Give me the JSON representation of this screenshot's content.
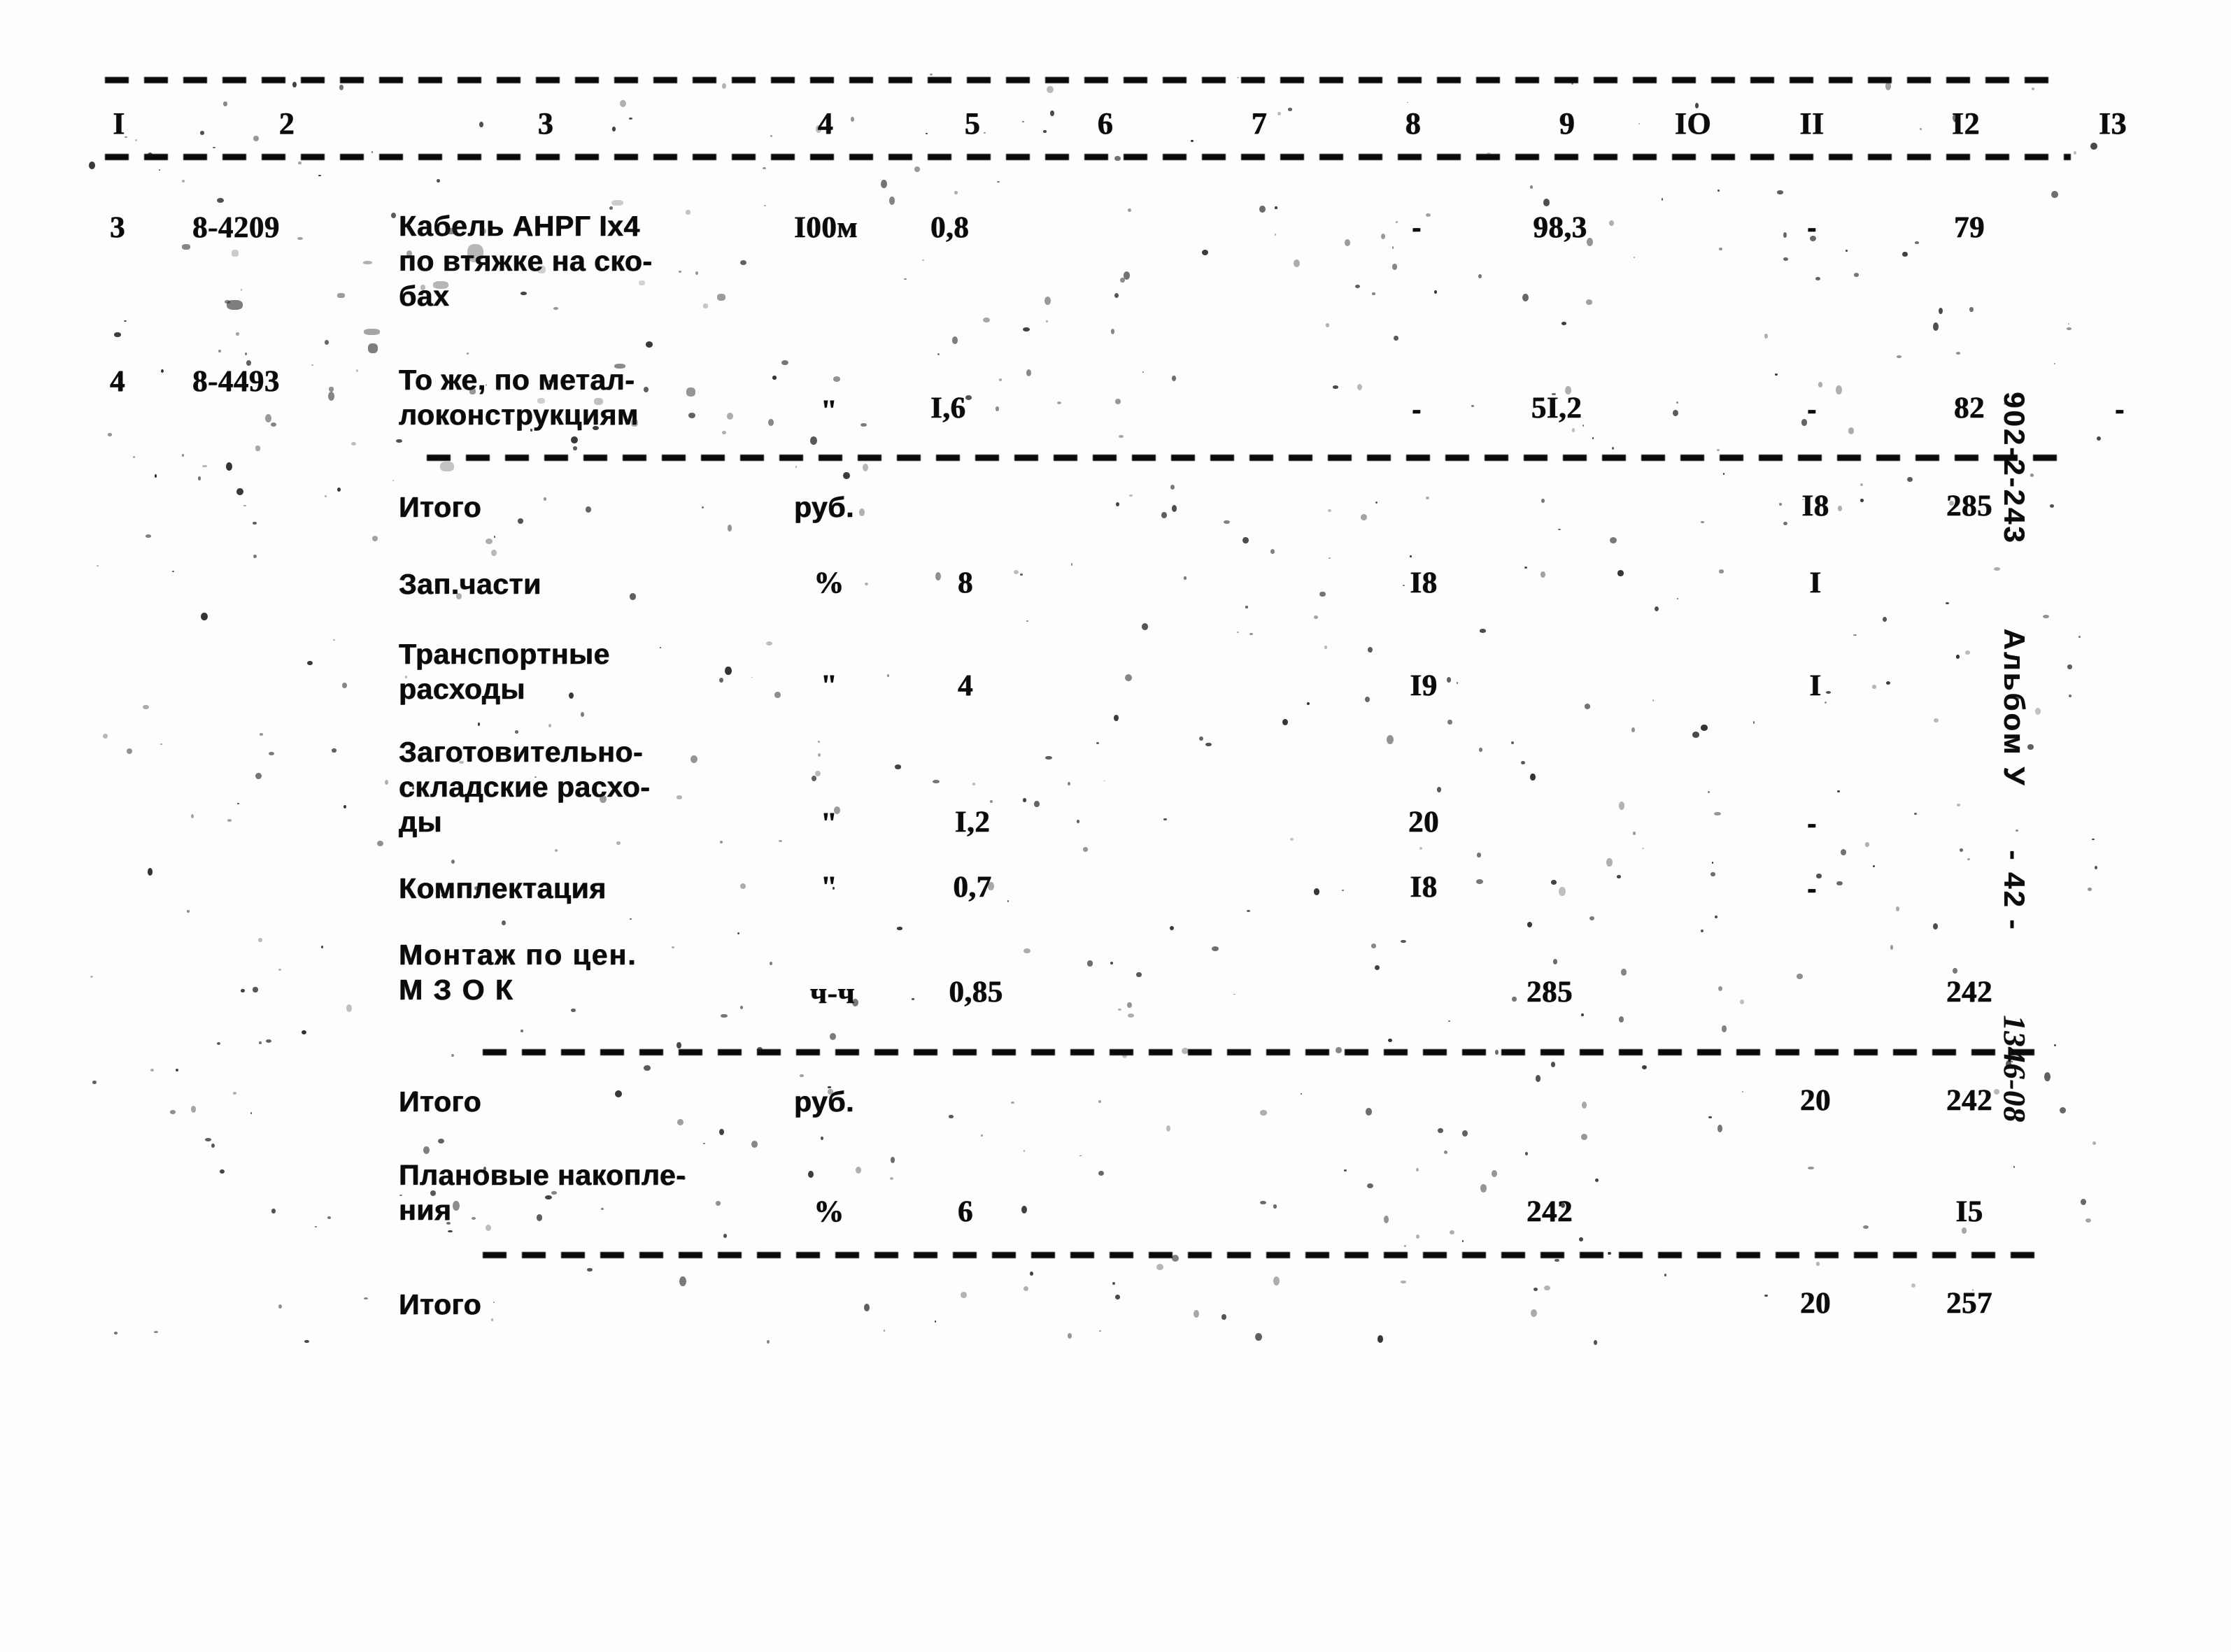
{
  "document": {
    "type": "scanned-estimate-table",
    "margin_stamp": {
      "code": "902-2-243",
      "album": "Альбом У",
      "page": "- 42 -",
      "annotation": "1346-08"
    }
  },
  "table": {
    "column_headers": [
      "I",
      "2",
      "3",
      "4",
      "5",
      "6",
      "7",
      "8",
      "9",
      "IO",
      "II",
      "I2",
      "I3"
    ],
    "rows": [
      {
        "kind": "item",
        "c1": "3",
        "c2": "8-4209",
        "c3": "Кабель АНРГ Iх4\nпо втяжке на ско-\nбах",
        "c4": "I00м",
        "c5": "0,8",
        "c6": "",
        "c7": "",
        "c8": "-",
        "c9": "98,3",
        "c10": "",
        "c11": "-",
        "c12": "79",
        "c13": ""
      },
      {
        "kind": "item",
        "c1": "4",
        "c2": "8-4493",
        "c3": "То же, по метал-\nлоконструкциям",
        "c4": "\"",
        "c5": "I,6",
        "c6": "",
        "c7": "",
        "c8": "-",
        "c9": "5I,2",
        "c10": "",
        "c11": "-",
        "c12": "82",
        "c13": "-"
      },
      {
        "kind": "total",
        "c1": "",
        "c2": "",
        "c3": "Итого",
        "c4": "руб.",
        "c5": "",
        "c6": "",
        "c7": "",
        "c8": "",
        "c9": "",
        "c10": "",
        "c11": "I8",
        "c12": "285",
        "c13": ""
      },
      {
        "kind": "item",
        "c1": "",
        "c2": "",
        "c3": "Зап.части",
        "c4": "%",
        "c5": "8",
        "c6": "",
        "c7": "",
        "c8": "I8",
        "c9": "",
        "c10": "",
        "c11": "I",
        "c12": "",
        "c13": ""
      },
      {
        "kind": "item",
        "c1": "",
        "c2": "",
        "c3": "Транспортные\nрасходы",
        "c4": "\"",
        "c5": "4",
        "c6": "",
        "c7": "",
        "c8": "I9",
        "c9": "",
        "c10": "",
        "c11": "I",
        "c12": "",
        "c13": ""
      },
      {
        "kind": "item",
        "c1": "",
        "c2": "",
        "c3": "Заготовительно-\nскладские расхо-\nды",
        "c4": "\"",
        "c5": "I,2",
        "c6": "",
        "c7": "",
        "c8": "20",
        "c9": "",
        "c10": "",
        "c11": "-",
        "c12": "",
        "c13": ""
      },
      {
        "kind": "item",
        "c1": "",
        "c2": "",
        "c3": "Комплектация",
        "c4": "\"",
        "c5": "0,7",
        "c6": "",
        "c7": "",
        "c8": "I8",
        "c9": "",
        "c10": "",
        "c11": "-",
        "c12": "",
        "c13": ""
      },
      {
        "kind": "item",
        "c1": "",
        "c2": "",
        "c3": "Монтаж по цен.\nМ З О К",
        "c4": "ч-ч",
        "c5": "0,85",
        "c6": "",
        "c7": "",
        "c8": "",
        "c9": "285",
        "c10": "",
        "c11": "",
        "c12": "242",
        "c13": ""
      },
      {
        "kind": "total",
        "c1": "",
        "c2": "",
        "c3": "Итого",
        "c4": "руб.",
        "c5": "",
        "c6": "",
        "c7": "",
        "c8": "",
        "c9": "",
        "c10": "",
        "c11": "20",
        "c12": "242",
        "c13": ""
      },
      {
        "kind": "item",
        "c1": "",
        "c2": "",
        "c3": "Плановые накопле-\nния",
        "c4": "%",
        "c5": "6",
        "c6": "",
        "c7": "",
        "c8": "",
        "c9": "242",
        "c10": "",
        "c11": "",
        "c12": "I5",
        "c13": ""
      },
      {
        "kind": "total",
        "c1": "",
        "c2": "",
        "c3": "Итого",
        "c4": "",
        "c5": "",
        "c6": "",
        "c7": "",
        "c8": "",
        "c9": "",
        "c10": "",
        "c11": "20",
        "c12": "257",
        "c13": ""
      }
    ]
  }
}
